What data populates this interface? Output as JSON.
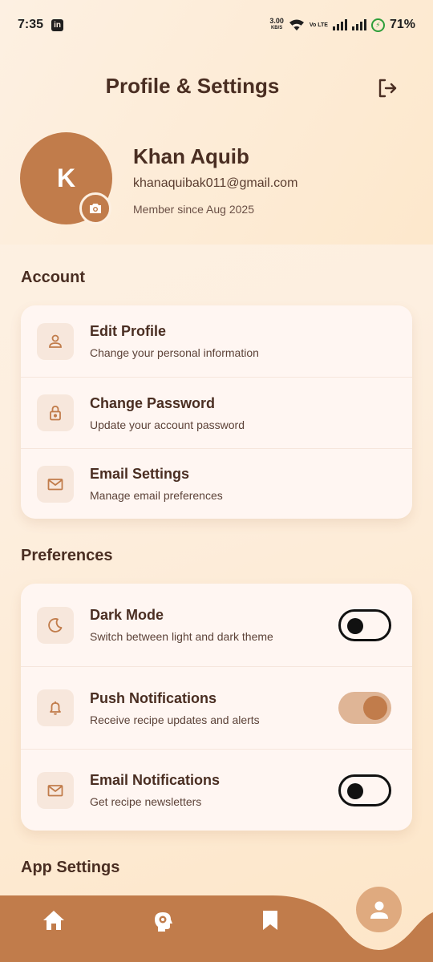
{
  "status_bar": {
    "time": "7:35",
    "app_badge": "in",
    "net_speed": "3.00",
    "net_unit": "KB/S",
    "volte": "Vo LTE",
    "battery": "71%"
  },
  "header": {
    "title": "Profile & Settings",
    "logout_icon": "logout-icon"
  },
  "profile": {
    "initial": "K",
    "name": "Khan Aquib",
    "email": "khanaquibak011@gmail.com",
    "member_since": "Member since Aug 2025"
  },
  "account": {
    "title": "Account",
    "items": [
      {
        "icon": "person-icon",
        "title": "Edit Profile",
        "subtitle": "Change your personal information"
      },
      {
        "icon": "lock-icon",
        "title": "Change Password",
        "subtitle": "Update your account password"
      },
      {
        "icon": "mail-icon",
        "title": "Email Settings",
        "subtitle": "Manage email preferences"
      }
    ]
  },
  "preferences": {
    "title": "Preferences",
    "items": [
      {
        "icon": "moon-icon",
        "title": "Dark Mode",
        "subtitle": "Switch between light and dark theme",
        "enabled": false
      },
      {
        "icon": "bell-icon",
        "title": "Push Notifications",
        "subtitle": "Receive recipe updates and alerts",
        "enabled": true
      },
      {
        "icon": "mail-icon",
        "title": "Email Notifications",
        "subtitle": "Get recipe newsletters",
        "enabled": false
      }
    ]
  },
  "app_settings": {
    "title": "App Settings"
  },
  "bottom_nav": {
    "items": [
      "home-icon",
      "chef-brain-icon",
      "bookmark-icon",
      "profile-icon"
    ],
    "active": "profile-icon"
  },
  "colors": {
    "accent": "#c17c4b",
    "text_dark": "#4a2e22",
    "card_bg": "#fff6f2",
    "nav_bg": "#c17c4b"
  }
}
